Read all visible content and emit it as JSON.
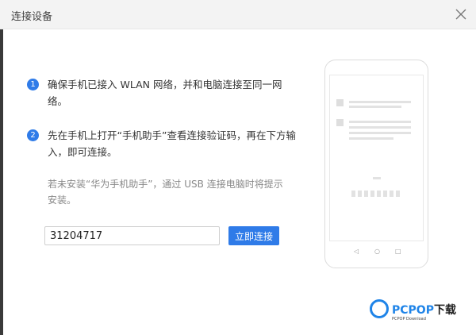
{
  "dialog": {
    "title": "连接设备",
    "close_icon": "close-icon"
  },
  "steps": [
    {
      "number": "1",
      "text": "确保手机已接入 WLAN 网络，并和电脑连接至同一网络。"
    },
    {
      "number": "2",
      "text": "先在手机上打开“手机助手”查看连接验证码，再在下方输入，即可连接。"
    }
  ],
  "note": "若未安装“华为手机助手”，通过 USB 连接电脑时将提示安装。",
  "code_input": {
    "value": "31204717"
  },
  "connect_button": {
    "label": "立即连接"
  },
  "phone_illustration": {
    "nav_icons": [
      "◁",
      "○",
      "□"
    ]
  },
  "watermark": {
    "brand": "PCPOP",
    "suffix": "下载",
    "sub": "PCPOP Download"
  },
  "colors": {
    "accent": "#2f7be8",
    "titlebar": "#f3f3f3",
    "watermark": "#1f84e8"
  }
}
